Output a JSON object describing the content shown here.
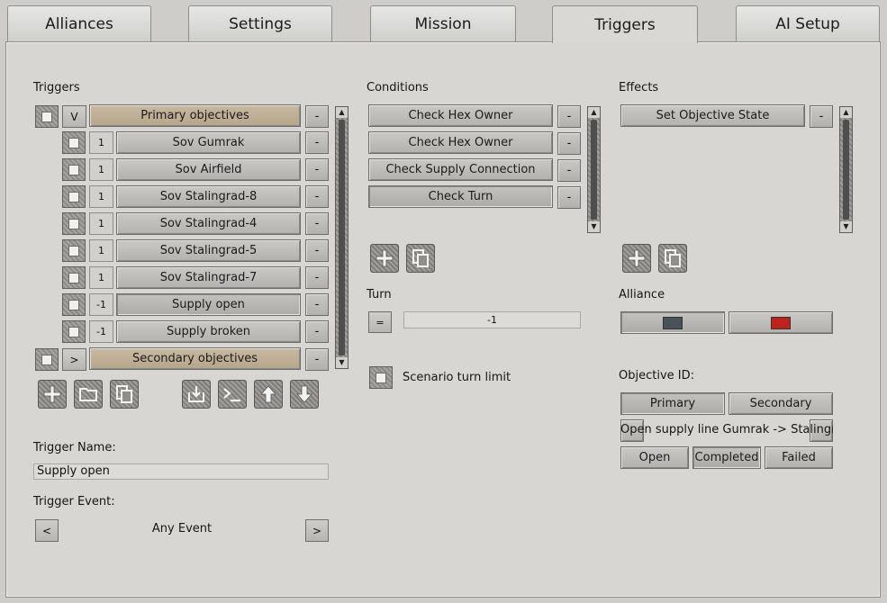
{
  "tabs": [
    "Alliances",
    "Settings",
    "Mission",
    "Triggers",
    "AI Setup"
  ],
  "triggers": {
    "label": "Triggers",
    "primary": {
      "expander": "V",
      "label": "Primary objectives",
      "remove": "-"
    },
    "items": [
      {
        "num": "1",
        "label": "Sov Gumrak"
      },
      {
        "num": "1",
        "label": "Sov Airfield"
      },
      {
        "num": "1",
        "label": "Sov Stalingrad-8"
      },
      {
        "num": "1",
        "label": "Sov Stalingrad-4"
      },
      {
        "num": "1",
        "label": "Sov Stalingrad-5"
      },
      {
        "num": "1",
        "label": "Sov Stalingrad-7"
      },
      {
        "num": "-1",
        "label": "Supply open"
      },
      {
        "num": "-1",
        "label": "Supply broken"
      }
    ],
    "secondary": {
      "expander": ">",
      "label": "Secondary objectives",
      "remove": "-"
    },
    "remove_label": "-",
    "toolbar_icons": [
      "plus-icon",
      "folder-icon",
      "copy-icon",
      "import-icon",
      "console-icon",
      "arrow-up-icon",
      "arrow-down-icon"
    ]
  },
  "trigger_name": {
    "label": "Trigger Name:",
    "value": "Supply open"
  },
  "trigger_event": {
    "label": "Trigger Event:",
    "value": "Any Event",
    "prev": "<",
    "next": ">"
  },
  "conditions": {
    "label": "Conditions",
    "items": [
      "Check Hex Owner",
      "Check Hex Owner",
      "Check Supply Connection",
      "Check Turn"
    ],
    "remove_label": "-"
  },
  "turn": {
    "label": "Turn",
    "operator": "=",
    "value": "-1"
  },
  "scenario_limit": {
    "label": "Scenario turn limit"
  },
  "effects": {
    "label": "Effects",
    "items": [
      "Set Objective State"
    ],
    "remove_label": "-"
  },
  "alliance": {
    "label": "Alliance",
    "colors": [
      "#4a5259",
      "#c0211c"
    ]
  },
  "objective": {
    "label": "Objective ID:",
    "types": [
      "Primary",
      "Secondary"
    ],
    "name": "Open supply line Gumrak -> Stalingrad.",
    "states": [
      "Open",
      "Completed",
      "Failed"
    ]
  }
}
